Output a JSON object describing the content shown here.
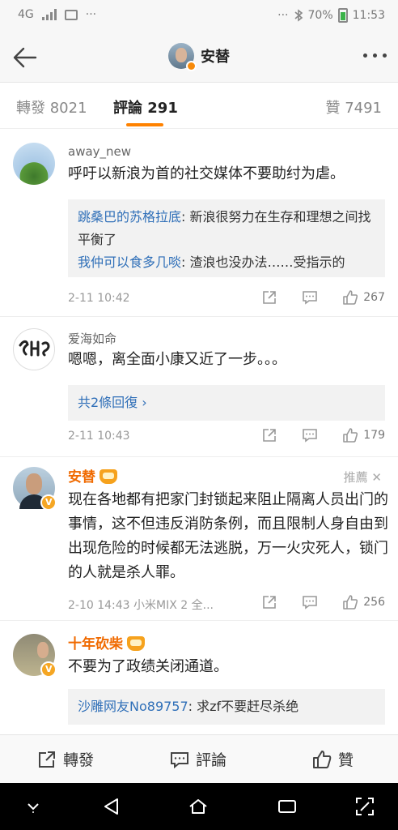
{
  "status_bar": {
    "network": "4G",
    "more": "···",
    "right_more": "···",
    "battery": "70%",
    "time": "11:53"
  },
  "header": {
    "title": "安替"
  },
  "tabs": {
    "repost": "轉發 8021",
    "comment": "評論 291",
    "like": "贊 7491"
  },
  "comments": [
    {
      "user": "away_new",
      "text": "呼吁以新浪为首的社交媒体不要助纣为虐。",
      "replies": [
        {
          "name": "跳桑巴的苏格拉底",
          "text": ": 新浪很努力在生存和理想之间找平衡了"
        },
        {
          "name": "我仲可以食多几啖",
          "text": ": 渣浪也没办法……受指示的"
        }
      ],
      "time": "2-11 10:42",
      "likes": "267"
    },
    {
      "user": "爱海如命",
      "text": "嗯嗯，离全面小康又近了一步。。。",
      "more_replies": "共2條回復 ›",
      "time": "2-11 10:43",
      "likes": "179"
    },
    {
      "user": "安替",
      "recommend": "推薦 ✕",
      "text": "现在各地都有把家门封锁起来阻止隔离人员出门的事情，这不但违反消防条例，而且限制人身自由到出现危险的时候都无法逃脱，万一火灾死人，锁门的人就是杀人罪。",
      "time": "2-10 14:43  小米MIX 2 全...",
      "likes": "256"
    },
    {
      "user": "十年砍柴",
      "text": "不要为了政绩关闭通道。",
      "replies": [
        {
          "name": "沙雕网友No89757",
          "text": ": 求zf不要赶尽杀绝"
        }
      ]
    }
  ],
  "bottom_bar": {
    "repost": "轉發",
    "comment": "評論",
    "like": "贊"
  },
  "colors": {
    "accent": "#ff8200",
    "link": "#2f6fb8",
    "vip_name": "#f06a00"
  }
}
